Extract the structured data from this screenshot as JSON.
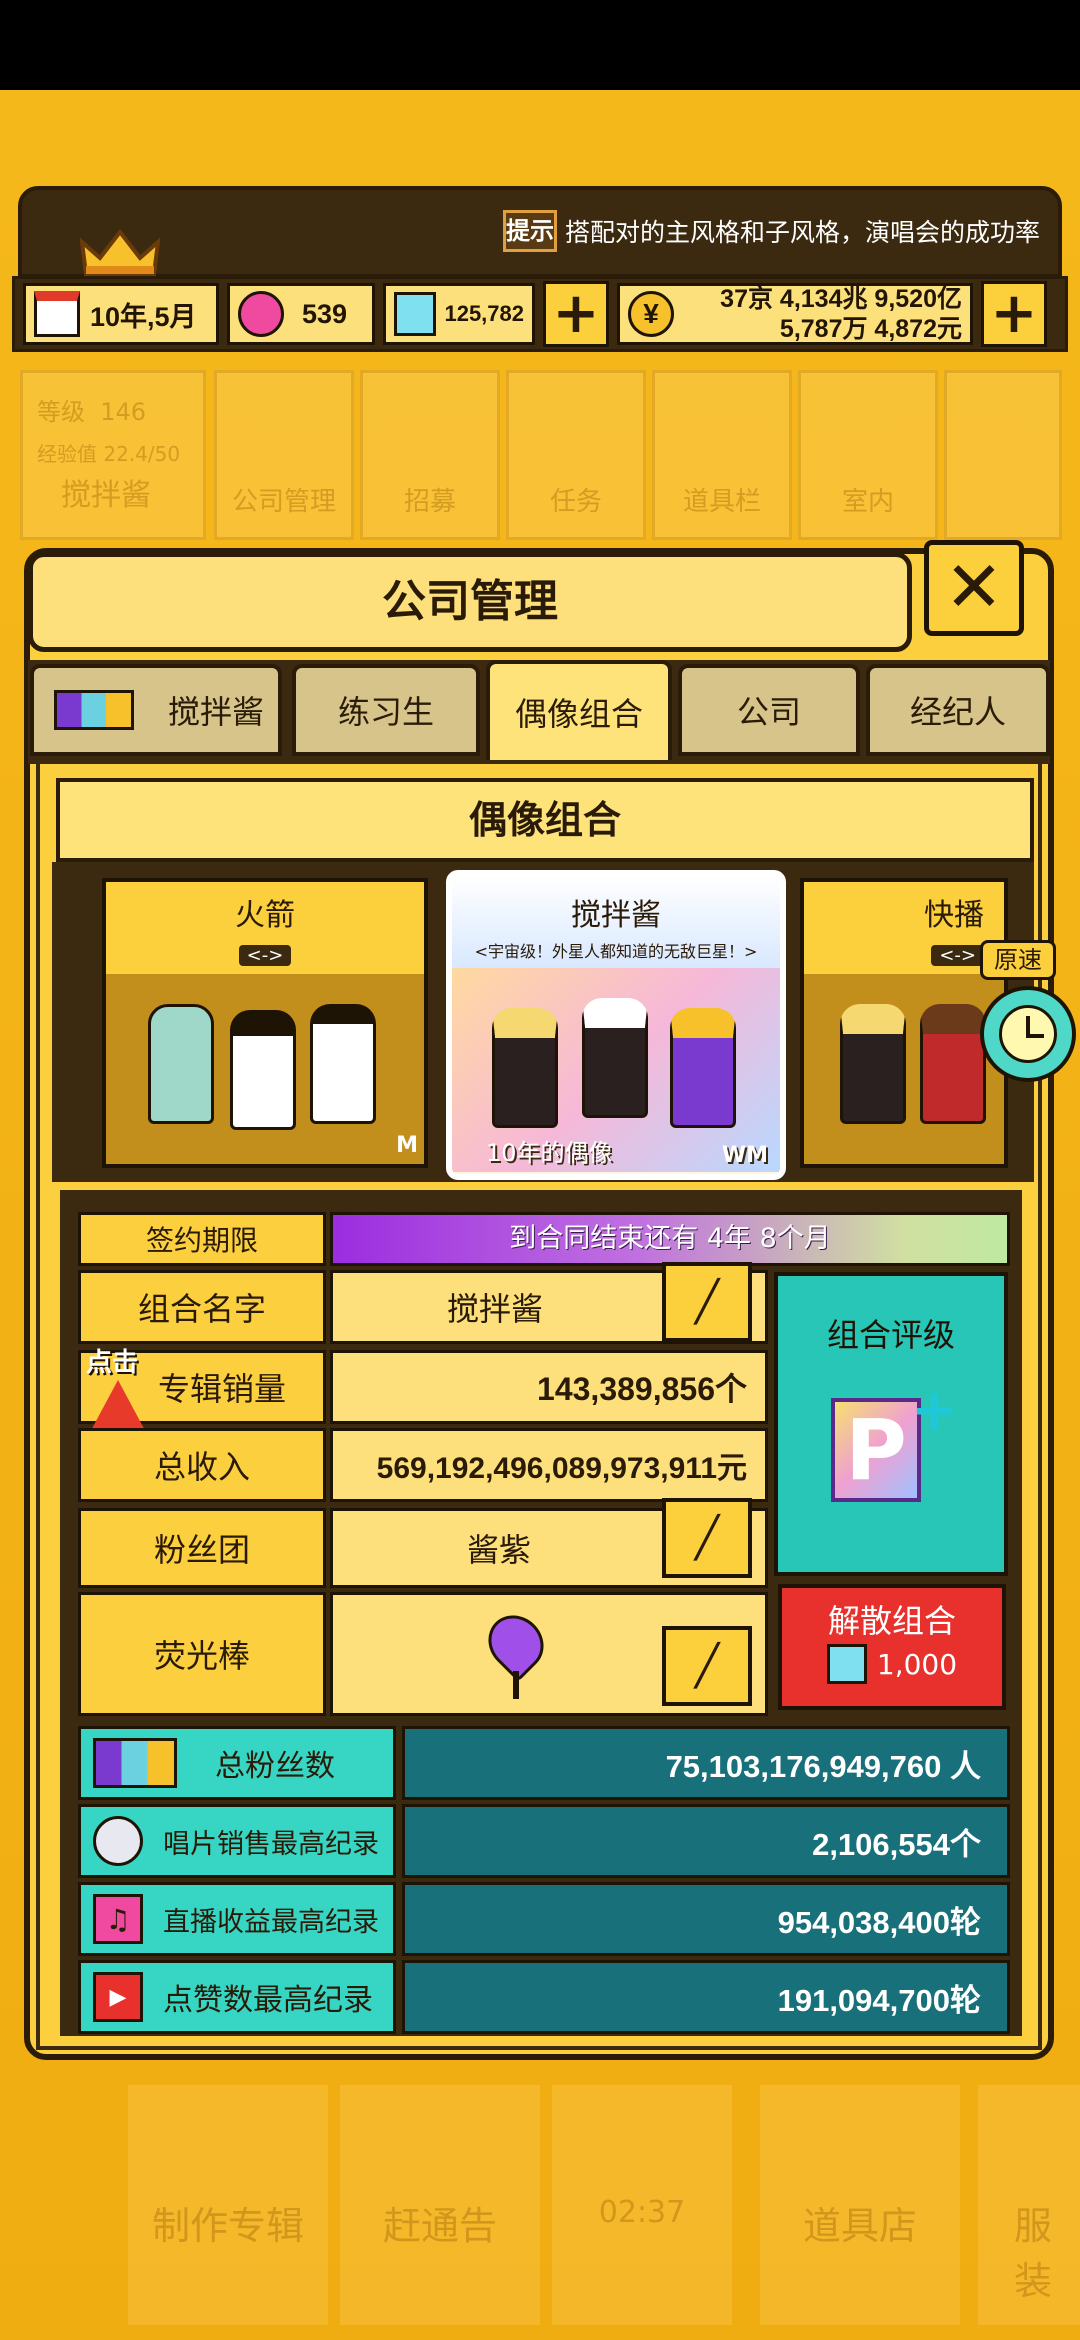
{
  "notice": {
    "badge": "提示",
    "text": "搭配对的主风格和子风格，演唱会的成功率"
  },
  "resources": {
    "date": "10年,5月",
    "gems": "539",
    "diamonds": "125,782",
    "money_line1": "37京 4,134兆 9,520亿",
    "money_line2": "5,787万 4,872元"
  },
  "faded_menu": {
    "level_label": "等级",
    "level_value": "146",
    "exp_label": "经验值",
    "exp_value": "22.4/50",
    "player_name": "搅拌酱",
    "items": [
      "公司管理",
      "招募",
      "任务",
      "道具栏",
      "室内"
    ]
  },
  "modal": {
    "title": "公司管理",
    "tabs": [
      "搅拌酱",
      "练习生",
      "偶像组合",
      "公司",
      "经纪人"
    ],
    "section_title": "偶像组合"
  },
  "groups": [
    {
      "name": "火箭",
      "arrows": "<->",
      "tag": "M"
    },
    {
      "name": "搅拌酱",
      "subtitle": "<宇宙级！外星人都知道的无敌巨星！>",
      "caption": "10年的偶像",
      "tag": "WM"
    },
    {
      "name": "快播",
      "arrows": "<->"
    }
  ],
  "speed_label": "原速",
  "details": {
    "contract_label": "签约期限",
    "contract_value": "到合同结束还有 4年 8个月",
    "name_label": "组合名字",
    "name_value": "搅拌酱",
    "album_label": "专辑销量",
    "album_value": "143,389,856个",
    "click_hint": "点击",
    "income_label": "总收入",
    "income_value": "569,192,496,089,973,911元",
    "fanclub_label": "粉丝团",
    "fanclub_value": "酱紫",
    "lightstick_label": "荧光棒",
    "rating_label": "组合评级",
    "disband_label": "解散组合",
    "disband_cost": "1,000"
  },
  "stats": [
    {
      "label": "总粉丝数",
      "value": "75,103,176,949,760 人"
    },
    {
      "label": "唱片销售最高纪录",
      "value": "2,106,554个"
    },
    {
      "label": "直播收益最高纪录",
      "value": "954,038,400轮"
    },
    {
      "label": "点赞数最高纪录",
      "value": "191,094,700轮"
    }
  ],
  "bottom_menu": [
    "制作专辑",
    "赶通告",
    "02:37",
    "道具店",
    "服装"
  ],
  "colors": {
    "accent": "#fbcf3d",
    "panel": "#3b2a10",
    "teal": "#18707a",
    "cyan": "#37d6c4",
    "red": "#e8312d"
  }
}
